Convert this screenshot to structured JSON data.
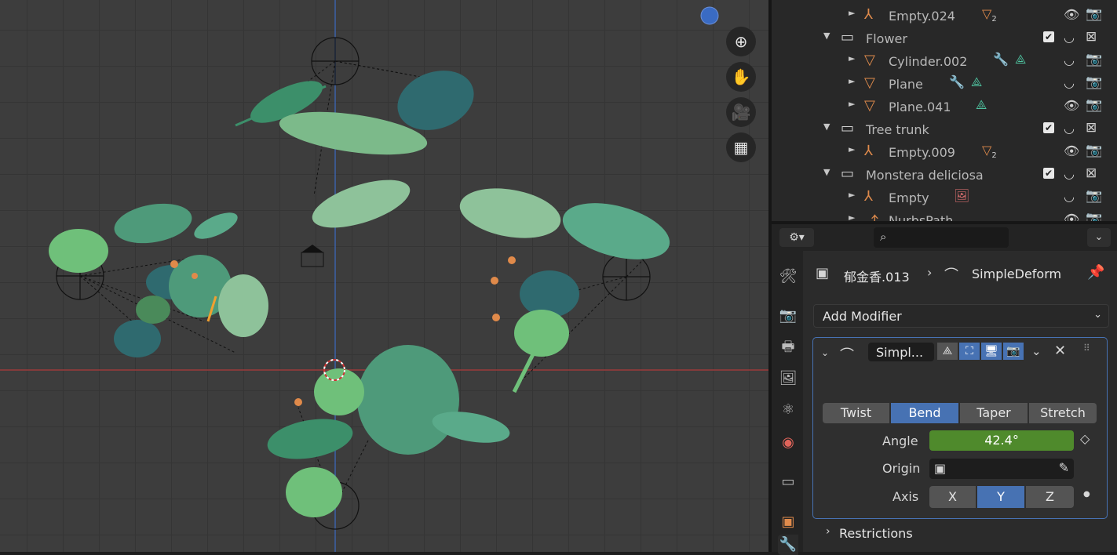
{
  "viewport": {
    "nav_icons": {
      "zoom": "zoom-in-icon",
      "pan": "hand-icon",
      "camera": "camera-view-icon",
      "grid": "ortho-grid-icon"
    },
    "colors": {
      "x_axis": "#9b3b3b",
      "y_axis": "#3c62a8",
      "leaf_light": "#7cba8a",
      "leaf_teal": "#2f6a6f",
      "leaf_mid": "#4e9a7a"
    }
  },
  "outliner": {
    "rows": [
      {
        "label": "Empty.024",
        "type": "empty",
        "badge": "2"
      },
      {
        "label": "Flower",
        "type": "collection"
      },
      {
        "label": "Cylinder.002",
        "type": "mesh"
      },
      {
        "label": "Plane",
        "type": "mesh"
      },
      {
        "label": "Plane.041",
        "type": "mesh"
      },
      {
        "label": "Tree trunk",
        "type": "collection"
      },
      {
        "label": "Empty.009",
        "type": "empty",
        "badge": "2"
      },
      {
        "label": "Monstera deliciosa",
        "type": "collection"
      },
      {
        "label": "Empty",
        "type": "empty"
      },
      {
        "label": "NurbsPath",
        "type": "curve"
      }
    ]
  },
  "properties": {
    "search_placeholder": "",
    "breadcrumb": {
      "object": "郁金香.013",
      "modifier": "SimpleDeform"
    },
    "add_modifier_label": "Add Modifier",
    "modifier": {
      "name": "Simpl...",
      "modes": [
        "Twist",
        "Bend",
        "Taper",
        "Stretch"
      ],
      "active_mode": "Bend",
      "angle_label": "Angle",
      "angle_value": "42.4°",
      "origin_label": "Origin",
      "axis_label": "Axis",
      "axes": [
        "X",
        "Y",
        "Z"
      ],
      "active_axis": "Y",
      "restrictions_label": "Restrictions"
    }
  }
}
